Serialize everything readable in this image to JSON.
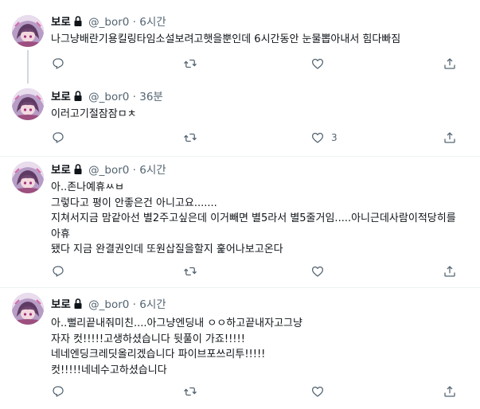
{
  "tweets": [
    {
      "name": "보로",
      "handle": "@_bor0",
      "separator": "·",
      "time": "6시간",
      "text": "나그냥배란기용킬링타임소설보려고햇을뿐인데 6시간동안 눈물뽑아내서 힘다빠짐",
      "reply_count": "",
      "retweet_count": "",
      "like_count": ""
    },
    {
      "name": "보로",
      "handle": "@_bor0",
      "separator": "·",
      "time": "36분",
      "text": "이러고기절잠잠ㅁㅊ",
      "reply_count": "",
      "retweet_count": "",
      "like_count": "3"
    },
    {
      "name": "보로",
      "handle": "@_bor0",
      "separator": "·",
      "time": "6시간",
      "text": "아..존나예휴ㅆㅂ\n그렇다고 평이 안좋은건 아니고요.......\n지쳐서지금 맘같아선 별2주고싶은데 이거빼면 별5라서 별5줄거임.....아니근데사람이적당히를\n아휴\n됐다 지금 완결권인데 또원삽질을할지 훑어나보고온다",
      "reply_count": "",
      "retweet_count": "",
      "like_count": ""
    },
    {
      "name": "보로",
      "handle": "@_bor0",
      "separator": "·",
      "time": "6시간",
      "text": "아..뻘리끝내줘미친....아그냥엔딩내 ㅇㅇ하고끝내자고그냥\n자자 컷!!!!!고생하셨습니다 뒷풀이 가죠!!!!!\n네네엔딩크레딧올리겠습니다 파이브포쓰리투!!!!!\n컷!!!!!네네수고하셨습니다",
      "reply_count": "",
      "retweet_count": "",
      "like_count": ""
    }
  ],
  "icons": {
    "lock": "lock-icon",
    "reply": "reply-icon",
    "retweet": "retweet-icon",
    "like": "heart-icon",
    "share": "share-icon"
  },
  "colors": {
    "text": "#0f1419",
    "muted": "#536471",
    "divider": "#eff3f4",
    "thread_line": "#cfd9de"
  }
}
